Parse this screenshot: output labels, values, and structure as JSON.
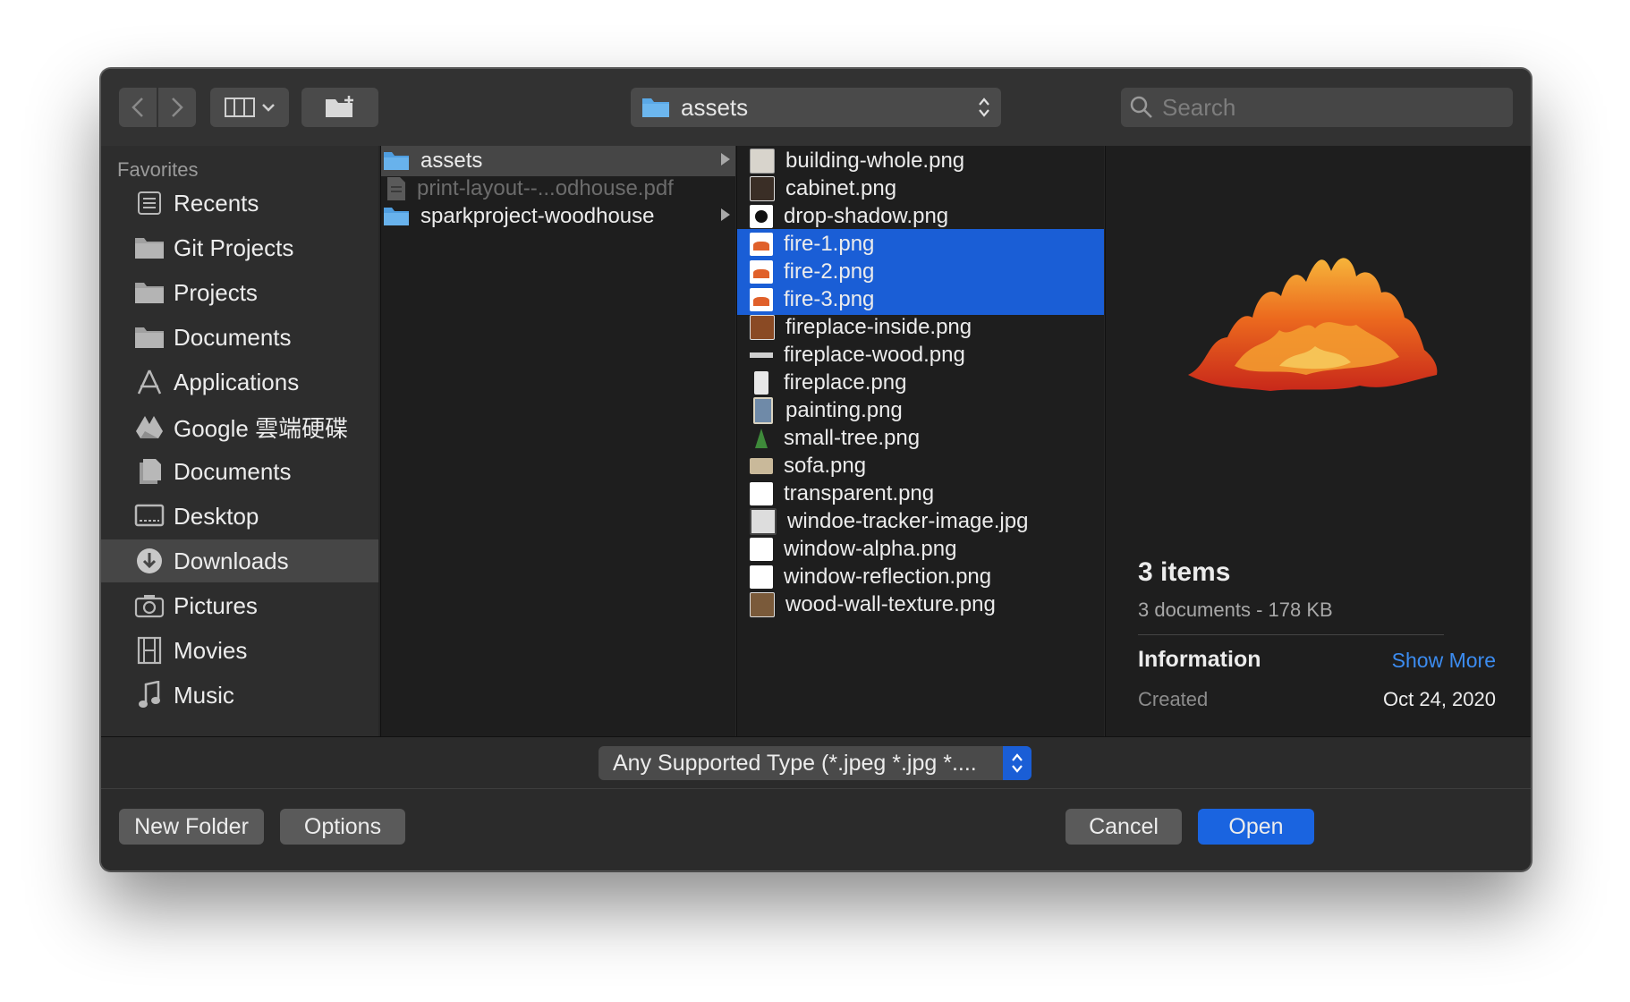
{
  "toolbar": {
    "back_icon": "chevron-left-icon",
    "forward_icon": "chevron-right-icon",
    "view_icon": "column-view-icon",
    "new_folder_icon": "folder-plus-icon",
    "path_label": "assets",
    "search_placeholder": "Search"
  },
  "sidebar": {
    "heading": "Favorites",
    "items": [
      {
        "label": "Recents",
        "icon": "recents-icon"
      },
      {
        "label": "Git Projects",
        "icon": "folder-icon"
      },
      {
        "label": "Projects",
        "icon": "folder-icon"
      },
      {
        "label": "Documents",
        "icon": "folder-icon"
      },
      {
        "label": "Applications",
        "icon": "applications-icon"
      },
      {
        "label": "Google 雲端硬碟",
        "icon": "google-drive-icon"
      },
      {
        "label": "Documents",
        "icon": "documents-icon"
      },
      {
        "label": "Desktop",
        "icon": "desktop-icon"
      },
      {
        "label": "Downloads",
        "icon": "downloads-icon",
        "active": true
      },
      {
        "label": "Pictures",
        "icon": "camera-icon"
      },
      {
        "label": "Movies",
        "icon": "film-icon"
      },
      {
        "label": "Music",
        "icon": "music-note-icon"
      }
    ]
  },
  "column1": {
    "items": [
      {
        "label": "assets",
        "kind": "folder",
        "selected": true
      },
      {
        "label": "print-layout--...odhouse.pdf",
        "kind": "pdf",
        "disabled": true
      },
      {
        "label": "sparkproject-woodhouse",
        "kind": "folder"
      }
    ]
  },
  "column2": {
    "items": [
      {
        "label": "building-whole.png"
      },
      {
        "label": "cabinet.png"
      },
      {
        "label": "drop-shadow.png"
      },
      {
        "label": "fire-1.png",
        "selected": true
      },
      {
        "label": "fire-2.png",
        "selected": true
      },
      {
        "label": "fire-3.png",
        "selected": true
      },
      {
        "label": "fireplace-inside.png"
      },
      {
        "label": "fireplace-wood.png"
      },
      {
        "label": "fireplace.png"
      },
      {
        "label": "painting.png"
      },
      {
        "label": "small-tree.png"
      },
      {
        "label": "sofa.png"
      },
      {
        "label": "transparent.png"
      },
      {
        "label": "windoe-tracker-image.jpg"
      },
      {
        "label": "window-alpha.png"
      },
      {
        "label": "window-reflection.png"
      },
      {
        "label": "wood-wall-texture.png"
      }
    ]
  },
  "preview": {
    "title": "3 items",
    "subtitle": "3 documents - 178 KB",
    "info_heading": "Information",
    "show_more": "Show More",
    "created_label": "Created",
    "created_value": "Oct 24, 2020"
  },
  "filter": {
    "type_label": "Any Supported Type (*.jpeg *.jpg *...."
  },
  "buttons": {
    "new_folder": "New Folder",
    "options": "Options",
    "cancel": "Cancel",
    "open": "Open"
  },
  "colors": {
    "selection_blue": "#1a5ed6",
    "link_blue": "#3c8cf0",
    "window_bg": "#262626"
  }
}
